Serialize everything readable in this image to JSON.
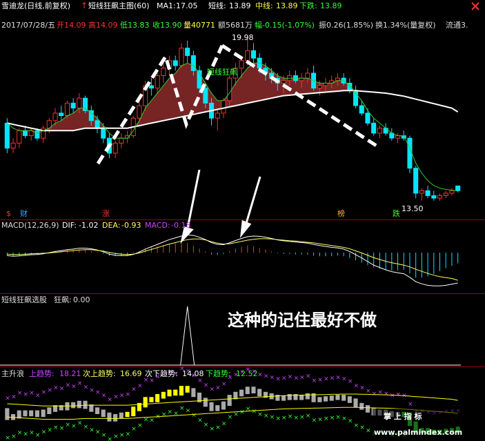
{
  "header": {
    "stock": "雪迪龙(日线,前复权)",
    "indicator": "短线狂飙主图(60)",
    "ma1_label": "MA1:",
    "ma1_value": "17.05",
    "short_label": "短线:",
    "short_value": "13.89",
    "mid_label": "中线:",
    "mid_value": "13.89",
    "down_label": "下跌:",
    "down_value": "13.89"
  },
  "quote": {
    "date": "2017/07/28/五",
    "open": "开14.09",
    "high": "高14.09",
    "low": "低13.83",
    "close": "收13.90",
    "volume": "量40771",
    "amount": "额5681万",
    "change": "幅-0.15(-1.07%)",
    "amplitude": "振0.26(1.85%)",
    "turnover": "换1.34%(量复权)",
    "float": "流通3."
  },
  "markers": {
    "high_price": "19.98",
    "low_price": "13.50",
    "tag_text": "短线狂飙"
  },
  "badges": [
    {
      "text": "$",
      "color": "#ff3030"
    },
    {
      "text": "财",
      "color": "#33aaff"
    },
    {
      "text": "涨",
      "color": "#ff3030"
    },
    {
      "text": "榜",
      "color": "#ffaa33"
    },
    {
      "text": "跌",
      "color": "#30ff30"
    }
  ],
  "macd": {
    "name": "MACD(12,26,9)",
    "dif_label": "DIF:",
    "dif_value": "-1.02",
    "dea_label": "DEA:",
    "dea_value": "-0.93",
    "macd_label": "MACD:",
    "macd_value": "-0.18"
  },
  "select": {
    "name": "短线狂飙选股",
    "label": "狂飙:",
    "value": "0.00"
  },
  "annotation": "这种的记住最好不做",
  "wave": {
    "name": "主升浪",
    "up_label": "上趋势:",
    "up_value": "18.21",
    "subup_label": "次上趋势:",
    "subup_value": "16.69",
    "subdown_label": "次下趋势:",
    "subdown_value": "14.08",
    "down_label": "下趋势:",
    "down_value": "12.52"
  },
  "watermark": {
    "line1": "掌 上 指 标",
    "line2": "www.palmindex.com"
  },
  "colors": {
    "up": "#ff3030",
    "down": "#00e5ff",
    "ma": "#ffffff",
    "short_line": "#33cc33",
    "dif": "#ffffff",
    "dea": "#ffff66",
    "macd_text": "#cc44ff",
    "trend_up": "#cc44ff",
    "trend_down": "#33ff33",
    "wave_band": "#ffff00"
  },
  "chart_data": {
    "type": "candlestick",
    "ohlc": [
      [
        16.6,
        16.8,
        15.4,
        15.6
      ],
      [
        15.6,
        16.0,
        15.4,
        15.8
      ],
      [
        15.8,
        16.4,
        15.6,
        16.3
      ],
      [
        16.3,
        16.5,
        16.0,
        16.1
      ],
      [
        16.1,
        16.4,
        15.9,
        16.3
      ],
      [
        16.3,
        16.4,
        15.9,
        16.0
      ],
      [
        16.0,
        16.5,
        15.8,
        16.4
      ],
      [
        16.4,
        16.8,
        16.2,
        16.7
      ],
      [
        16.7,
        17.2,
        16.5,
        17.0
      ],
      [
        17.0,
        17.3,
        16.7,
        16.9
      ],
      [
        16.9,
        17.5,
        16.8,
        17.4
      ],
      [
        17.4,
        17.6,
        17.0,
        17.2
      ],
      [
        17.2,
        17.8,
        17.0,
        17.6
      ],
      [
        17.6,
        17.7,
        17.0,
        17.1
      ],
      [
        17.1,
        17.3,
        16.5,
        16.7
      ],
      [
        16.7,
        16.9,
        16.2,
        16.4
      ],
      [
        16.4,
        16.6,
        15.8,
        16.0
      ],
      [
        16.0,
        16.2,
        15.2,
        15.4
      ],
      [
        15.4,
        15.9,
        15.2,
        15.8
      ],
      [
        15.8,
        16.2,
        15.6,
        16.0
      ],
      [
        16.0,
        16.3,
        15.8,
        16.1
      ],
      [
        16.1,
        16.9,
        16.0,
        16.8
      ],
      [
        16.8,
        17.5,
        16.6,
        17.3
      ],
      [
        17.3,
        18.3,
        17.1,
        18.1
      ],
      [
        18.1,
        18.4,
        17.7,
        18.0
      ],
      [
        18.0,
        18.6,
        17.8,
        18.5
      ],
      [
        18.5,
        19.0,
        18.2,
        18.8
      ],
      [
        18.8,
        19.3,
        18.5,
        19.1
      ],
      [
        19.1,
        19.3,
        18.7,
        18.9
      ],
      [
        18.9,
        19.8,
        18.8,
        19.6
      ],
      [
        19.6,
        19.9,
        19.0,
        19.3
      ],
      [
        19.3,
        19.5,
        18.5,
        18.7
      ],
      [
        18.7,
        18.9,
        17.8,
        18.0
      ],
      [
        18.0,
        18.2,
        17.2,
        17.4
      ],
      [
        17.4,
        17.6,
        16.5,
        16.8
      ],
      [
        16.8,
        17.2,
        16.3,
        17.0
      ],
      [
        17.0,
        17.6,
        16.8,
        17.5
      ],
      [
        17.5,
        18.5,
        17.3,
        18.4
      ],
      [
        18.4,
        19.0,
        18.1,
        18.8
      ],
      [
        18.8,
        19.3,
        18.4,
        19.1
      ],
      [
        19.1,
        19.98,
        18.9,
        19.5
      ],
      [
        19.5,
        19.8,
        19.0,
        19.2
      ],
      [
        19.2,
        19.4,
        18.6,
        18.8
      ],
      [
        18.8,
        19.0,
        18.3,
        18.6
      ],
      [
        18.6,
        18.8,
        18.2,
        18.4
      ],
      [
        18.4,
        18.6,
        17.9,
        18.2
      ],
      [
        18.2,
        18.5,
        17.8,
        18.3
      ],
      [
        18.3,
        18.7,
        18.1,
        18.5
      ],
      [
        18.5,
        18.7,
        18.2,
        18.3
      ],
      [
        18.3,
        18.6,
        18.0,
        18.4
      ],
      [
        18.4,
        18.8,
        18.2,
        18.6
      ],
      [
        18.6,
        18.9,
        17.9,
        18.0
      ],
      [
        18.0,
        18.3,
        17.7,
        18.1
      ],
      [
        18.1,
        18.4,
        17.9,
        18.2
      ],
      [
        18.2,
        18.5,
        18.0,
        18.3
      ],
      [
        18.3,
        18.6,
        18.1,
        18.4
      ],
      [
        18.4,
        18.6,
        18.1,
        18.2
      ],
      [
        18.2,
        18.4,
        17.8,
        17.9
      ],
      [
        17.9,
        18.1,
        17.2,
        17.3
      ],
      [
        17.3,
        17.5,
        16.9,
        17.0
      ],
      [
        17.0,
        17.2,
        16.5,
        16.6
      ],
      [
        16.6,
        16.8,
        16.1,
        16.2
      ],
      [
        16.2,
        16.5,
        16.0,
        16.4
      ],
      [
        16.4,
        16.6,
        16.1,
        16.2
      ],
      [
        16.2,
        16.4,
        15.9,
        16.0
      ],
      [
        16.0,
        16.2,
        15.8,
        16.1
      ],
      [
        16.1,
        16.3,
        15.9,
        16.0
      ],
      [
        16.0,
        16.1,
        14.6,
        14.8
      ],
      [
        14.8,
        14.9,
        13.6,
        13.8
      ],
      [
        13.8,
        14.0,
        13.5,
        13.9
      ],
      [
        13.9,
        14.1,
        13.6,
        13.7
      ],
      [
        13.7,
        13.9,
        13.5,
        13.6
      ],
      [
        13.6,
        13.8,
        13.5,
        13.7
      ],
      [
        13.7,
        13.9,
        13.6,
        13.8
      ],
      [
        13.8,
        14.0,
        13.7,
        13.9
      ],
      [
        14.09,
        14.09,
        13.83,
        13.9
      ]
    ],
    "ma1": [
      16.6,
      16.55,
      16.5,
      16.45,
      16.4,
      16.35,
      16.3,
      16.3,
      16.3,
      16.3,
      16.3,
      16.3,
      16.35,
      16.4,
      16.4,
      16.4,
      16.4,
      16.4,
      16.4,
      16.4,
      16.4,
      16.45,
      16.5,
      16.55,
      16.6,
      16.65,
      16.7,
      16.75,
      16.8,
      16.85,
      16.9,
      16.95,
      17.0,
      17.05,
      17.1,
      17.15,
      17.2,
      17.25,
      17.3,
      17.35,
      17.4,
      17.45,
      17.5,
      17.55,
      17.6,
      17.65,
      17.7,
      17.72,
      17.74,
      17.76,
      17.78,
      17.8,
      17.82,
      17.84,
      17.86,
      17.88,
      17.9,
      17.9,
      17.9,
      17.88,
      17.86,
      17.84,
      17.82,
      17.8,
      17.76,
      17.72,
      17.68,
      17.62,
      17.56,
      17.5,
      17.44,
      17.38,
      17.32,
      17.26,
      17.2,
      17.05
    ],
    "short_line": [
      16.6,
      16.4,
      16.3,
      16.3,
      16.3,
      16.2,
      16.3,
      16.4,
      16.6,
      16.7,
      16.9,
      17.0,
      17.2,
      17.2,
      17.0,
      16.8,
      16.5,
      16.2,
      16.0,
      16.0,
      16.0,
      16.3,
      16.7,
      17.2,
      17.5,
      17.8,
      18.1,
      18.4,
      18.6,
      18.9,
      19.0,
      18.9,
      18.6,
      18.2,
      17.8,
      17.5,
      17.5,
      17.8,
      18.2,
      18.5,
      18.8,
      19.0,
      19.0,
      18.9,
      18.7,
      18.5,
      18.4,
      18.4,
      18.4,
      18.4,
      18.4,
      18.3,
      18.2,
      18.2,
      18.2,
      18.3,
      18.3,
      18.1,
      17.8,
      17.5,
      17.1,
      16.8,
      16.6,
      16.4,
      16.2,
      16.1,
      16.1,
      15.6,
      15.0,
      14.6,
      14.3,
      14.1,
      14.0,
      13.95,
      13.92,
      13.89
    ],
    "macd_hist": [
      -0.05,
      -0.06,
      -0.05,
      -0.04,
      -0.03,
      -0.03,
      -0.02,
      0.01,
      0.03,
      0.04,
      0.05,
      0.05,
      0.06,
      0.05,
      0.03,
      0.01,
      -0.02,
      -0.05,
      -0.06,
      -0.05,
      -0.04,
      -0.01,
      0.03,
      0.07,
      0.09,
      0.11,
      0.13,
      0.15,
      0.16,
      0.17,
      0.16,
      0.12,
      0.07,
      0.02,
      -0.03,
      -0.04,
      -0.02,
      0.03,
      0.07,
      0.1,
      0.12,
      0.11,
      0.08,
      0.05,
      0.02,
      -0.01,
      -0.02,
      -0.02,
      -0.03,
      -0.03,
      -0.03,
      -0.05,
      -0.06,
      -0.06,
      -0.06,
      -0.05,
      -0.06,
      -0.09,
      -0.13,
      -0.17,
      -0.21,
      -0.25,
      -0.27,
      -0.29,
      -0.3,
      -0.3,
      -0.29,
      -0.35,
      -0.42,
      -0.42,
      -0.4,
      -0.36,
      -0.31,
      -0.26,
      -0.22,
      -0.18
    ],
    "dif": [
      -0.1,
      -0.12,
      -0.11,
      -0.09,
      -0.07,
      -0.06,
      -0.04,
      0.0,
      0.04,
      0.07,
      0.1,
      0.12,
      0.15,
      0.15,
      0.13,
      0.09,
      0.03,
      -0.05,
      -0.09,
      -0.1,
      -0.1,
      -0.06,
      0.02,
      0.12,
      0.2,
      0.28,
      0.36,
      0.44,
      0.5,
      0.56,
      0.6,
      0.58,
      0.52,
      0.44,
      0.34,
      0.28,
      0.27,
      0.33,
      0.41,
      0.48,
      0.54,
      0.56,
      0.55,
      0.52,
      0.48,
      0.43,
      0.4,
      0.38,
      0.36,
      0.34,
      0.32,
      0.28,
      0.24,
      0.21,
      0.18,
      0.16,
      0.12,
      0.04,
      -0.07,
      -0.18,
      -0.3,
      -0.42,
      -0.5,
      -0.58,
      -0.64,
      -0.68,
      -0.71,
      -0.83,
      -0.98,
      -1.05,
      -1.1,
      -1.12,
      -1.12,
      -1.1,
      -1.06,
      -1.02
    ],
    "dea": [
      -0.05,
      -0.06,
      -0.06,
      -0.05,
      -0.04,
      -0.03,
      -0.02,
      -0.01,
      0.01,
      0.03,
      0.05,
      0.07,
      0.09,
      0.1,
      0.1,
      0.08,
      0.05,
      0.01,
      -0.03,
      -0.05,
      -0.06,
      -0.05,
      -0.01,
      0.05,
      0.11,
      0.17,
      0.23,
      0.29,
      0.34,
      0.39,
      0.44,
      0.46,
      0.46,
      0.43,
      0.37,
      0.32,
      0.29,
      0.3,
      0.34,
      0.38,
      0.42,
      0.45,
      0.47,
      0.47,
      0.46,
      0.44,
      0.42,
      0.4,
      0.39,
      0.37,
      0.35,
      0.33,
      0.3,
      0.27,
      0.24,
      0.21,
      0.18,
      0.13,
      0.06,
      -0.01,
      -0.09,
      -0.17,
      -0.23,
      -0.29,
      -0.34,
      -0.38,
      -0.42,
      -0.48,
      -0.56,
      -0.63,
      -0.7,
      -0.76,
      -0.81,
      -0.84,
      -0.87,
      -0.93
    ],
    "select_signal_index": 30,
    "ylim_price": [
      13.3,
      20.2
    ],
    "ylim_macd": [
      -1.3,
      0.7
    ]
  }
}
